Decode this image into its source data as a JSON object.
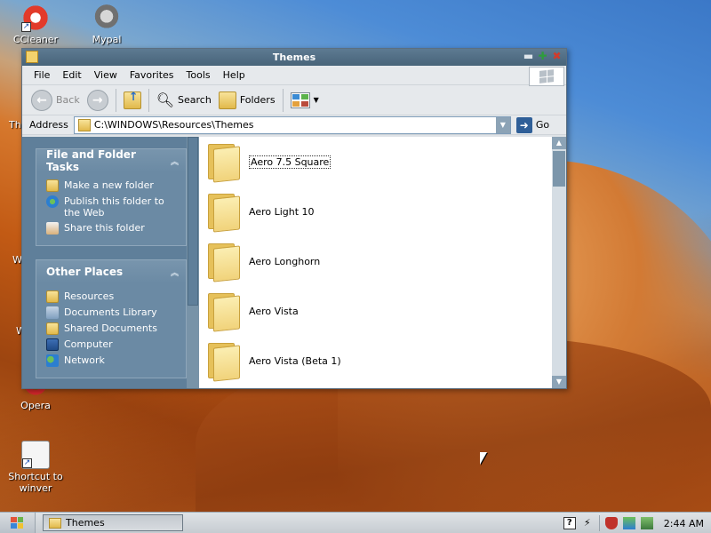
{
  "desktop": {
    "icons": {
      "ccleaner": "CCleaner",
      "mypal": "Mypal",
      "opera": "Opera",
      "winver_line1": "Shortcut to",
      "winver_line2": "winver"
    },
    "edge_fragments": {
      "th": "Th",
      "w1": "W",
      "w2": "W"
    }
  },
  "window": {
    "title": "Themes",
    "menu": [
      "File",
      "Edit",
      "View",
      "Favorites",
      "Tools",
      "Help"
    ],
    "toolbar": {
      "back": "Back",
      "search": "Search",
      "folders": "Folders"
    },
    "address": {
      "label": "Address",
      "value": "C:\\WINDOWS\\Resources\\Themes",
      "go": "Go"
    },
    "tasks_panel": {
      "title": "File and Folder Tasks",
      "items": [
        "Make a new folder",
        "Publish this folder to the Web",
        "Share this folder"
      ]
    },
    "places_panel": {
      "title": "Other Places",
      "items": [
        "Resources",
        "Documents Library",
        "Shared Documents",
        "Computer",
        "Network"
      ]
    },
    "files": [
      "Aero 7.5 Square",
      "Aero Light 10",
      "Aero Longhorn",
      "Aero Vista",
      "Aero Vista (Beta 1)"
    ]
  },
  "taskbar": {
    "task_label": "Themes",
    "clock": "2:44 AM"
  },
  "colors": {
    "titlebar": "#486479",
    "taskpane": "#5f7f9a",
    "desktop_sky": "#3b78c7",
    "desktop_sand": "#d6782d"
  }
}
